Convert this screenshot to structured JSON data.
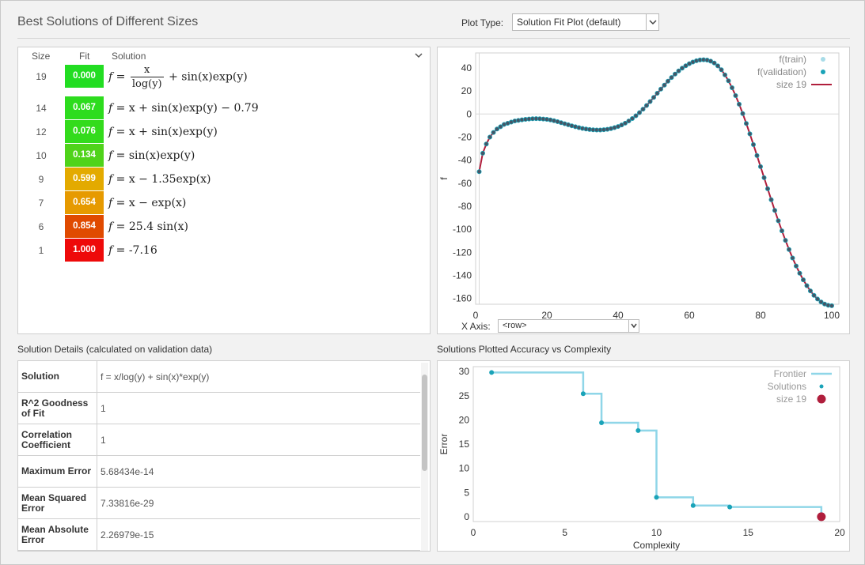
{
  "header": {
    "title": "Best Solutions of Different Sizes",
    "plot_type_label": "Plot Type:",
    "plot_type_value": "Solution Fit Plot (default)"
  },
  "solutions_table": {
    "columns": [
      "Size",
      "Fit",
      "Solution"
    ],
    "rows": [
      {
        "size": "19",
        "fit": "0.000",
        "fit_color": "#22dd22"
      },
      {
        "size": "14",
        "fit": "0.067",
        "fit_color": "#2ddc1e",
        "formula": "= x + sin(x)exp(y) − 0.79"
      },
      {
        "size": "12",
        "fit": "0.076",
        "fit_color": "#33db1c",
        "formula": "= x + sin(x)exp(y)"
      },
      {
        "size": "10",
        "fit": "0.134",
        "fit_color": "#4fd31a",
        "formula": "= sin(x)exp(y)"
      },
      {
        "size": "9",
        "fit": "0.599",
        "fit_color": "#e3aa00",
        "formula": "= x − 1.35exp(x)"
      },
      {
        "size": "7",
        "fit": "0.654",
        "fit_color": "#e69a00",
        "formula": "= x − exp(x)"
      },
      {
        "size": "6",
        "fit": "0.854",
        "fit_color": "#e04a00",
        "formula": "= 25.4 sin(x)"
      },
      {
        "size": "1",
        "fit": "1.000",
        "fit_color": "#ee0a0a",
        "formula": "= -7.16"
      }
    ],
    "row0_formula": {
      "lhs": "=",
      "num": "x",
      "den": "log(y)",
      "rhs": "+ sin(x)exp(y)"
    }
  },
  "details": {
    "title": "Solution Details (calculated on validation data)",
    "rows": [
      {
        "key": "Solution",
        "value": "f = x/log(y) + sin(x)*exp(y)"
      },
      {
        "key": "R^2 Goodness of Fit",
        "value": "1"
      },
      {
        "key": "Correlation Coefficient",
        "value": "1"
      },
      {
        "key": "Maximum Error",
        "value": "5.68434e-14"
      },
      {
        "key": "Mean Squared Error",
        "value": "7.33816e-29"
      },
      {
        "key": "Mean Absolute Error",
        "value": "2.26979e-15"
      }
    ]
  },
  "fit_plot": {
    "xaxis_label": "X Axis:",
    "xaxis_value": "<row>",
    "y_label": "f",
    "legend": [
      "f(train)",
      "f(validation)",
      "size 19"
    ],
    "colors": {
      "train": "#a8dce8",
      "validation": "#1aa3b8",
      "line": "#b01e3c",
      "point": "#445566"
    }
  },
  "accuracy_plot": {
    "title": "Solutions Plotted Accuracy vs Complexity",
    "x_label": "Complexity",
    "y_label": "Error",
    "legend": [
      "Frontier",
      "Solutions",
      "size 19"
    ],
    "colors": {
      "frontier": "#8fd6e8",
      "solutions": "#1aa3b8",
      "selected": "#b01e3c"
    }
  },
  "chart_data": [
    {
      "type": "line",
      "x": [
        1,
        2,
        3,
        4,
        5,
        6,
        7,
        8,
        9,
        10,
        11,
        12,
        13,
        14,
        15,
        16,
        17,
        18,
        19,
        20,
        21,
        22,
        23,
        24,
        25,
        26,
        27,
        28,
        29,
        30,
        31,
        32,
        33,
        34,
        35,
        36,
        37,
        38,
        39,
        40,
        41,
        42,
        43,
        44,
        45,
        46,
        47,
        48,
        49,
        50,
        51,
        52,
        53,
        54,
        55,
        56,
        57,
        58,
        59,
        60,
        61,
        62,
        63,
        64,
        65,
        66,
        67,
        68,
        69,
        70,
        71,
        72,
        73,
        74,
        75,
        76,
        77,
        78,
        79,
        80,
        81,
        82,
        83,
        84,
        85,
        86,
        87,
        88,
        89,
        90,
        91,
        92,
        93,
        94,
        95,
        96,
        97,
        98,
        99,
        100
      ],
      "series": [
        {
          "name": "size 19",
          "values": [
            -50,
            -34,
            -26,
            -20,
            -16,
            -13,
            -11,
            -9,
            -8,
            -7,
            -6,
            -5.5,
            -5,
            -4.6,
            -4.3,
            -4.1,
            -4,
            -4.1,
            -4.3,
            -4.6,
            -5.1,
            -5.8,
            -6.6,
            -7.5,
            -8.4,
            -9.3,
            -10.2,
            -11,
            -11.8,
            -12.5,
            -13,
            -13.4,
            -13.7,
            -13.8,
            -13.8,
            -13.6,
            -13.2,
            -12.6,
            -11.8,
            -10.8,
            -9.5,
            -7.9,
            -6,
            -3.9,
            -1.5,
            1.2,
            4.2,
            7.4,
            10.8,
            14.4,
            18,
            21.6,
            25.1,
            28.5,
            31.7,
            34.7,
            37.4,
            39.8,
            41.9,
            43.7,
            45.1,
            46.2,
            46.9,
            47.1,
            46.8,
            45.9,
            44.3,
            41.8,
            38.4,
            34,
            28.8,
            22.8,
            16,
            8.5,
            0.4,
            -8.2,
            -17.2,
            -26.5,
            -36,
            -45.6,
            -55.2,
            -64.8,
            -74.3,
            -83.6,
            -92.6,
            -101.3,
            -109.6,
            -117.5,
            -124.9,
            -131.8,
            -138.1,
            -143.8,
            -148.9,
            -153.4,
            -157.3,
            -160.5,
            -163,
            -164.8,
            -165.9,
            -166.3
          ]
        }
      ],
      "xlim": [
        0,
        102
      ],
      "ylim": [
        -165,
        53
      ],
      "yticks": [
        40,
        20,
        0,
        -20,
        -40,
        -60,
        -80,
        -100,
        -120,
        -140,
        -160
      ],
      "xticks": [
        0,
        20,
        40,
        60,
        80,
        100
      ],
      "ylabel": "f"
    },
    {
      "type": "scatter",
      "title": "Solutions Plotted Accuracy vs Complexity",
      "xlabel": "Complexity",
      "ylabel": "Error",
      "xlim": [
        0,
        20
      ],
      "ylim": [
        -1,
        31
      ],
      "xticks": [
        0,
        5,
        10,
        15,
        20
      ],
      "yticks": [
        30,
        25,
        20,
        15,
        10,
        5,
        0
      ],
      "series": [
        {
          "name": "Solutions",
          "x": [
            1,
            6,
            7,
            9,
            10,
            12,
            14,
            19
          ],
          "y": [
            29.8,
            25.4,
            19.4,
            17.8,
            4.0,
            2.3,
            2.0,
            0
          ]
        },
        {
          "name": "Frontier",
          "x": [
            1,
            6,
            6,
            7,
            7,
            9,
            9,
            10,
            10,
            12,
            12,
            14,
            14,
            19,
            19
          ],
          "y": [
            29.8,
            29.8,
            25.4,
            25.4,
            19.4,
            19.4,
            17.8,
            17.8,
            4.0,
            4.0,
            2.3,
            2.3,
            2.0,
            2.0,
            0
          ]
        },
        {
          "name": "size 19",
          "x": [
            19
          ],
          "y": [
            0
          ]
        }
      ]
    }
  ]
}
